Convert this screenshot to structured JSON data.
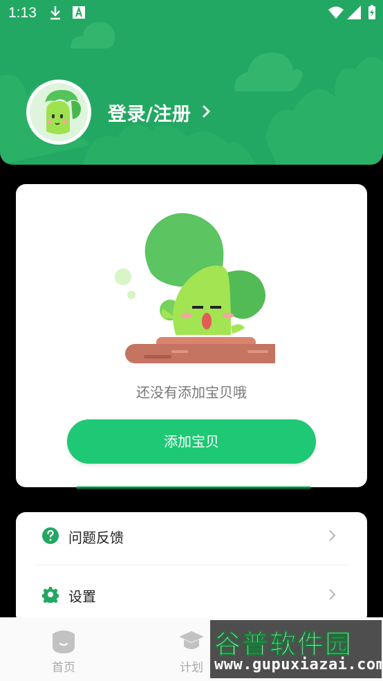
{
  "status_bar": {
    "time": "1:13",
    "icons": [
      "download-icon",
      "a11y-icon",
      "wifi-icon",
      "signal-icon",
      "battery-icon"
    ]
  },
  "header": {
    "login_label": "登录/注册",
    "chevron": "›",
    "bg_color": "#22a862"
  },
  "baby_card": {
    "empty_text": "还没有添加宝贝哦",
    "add_button_label": "添加宝贝",
    "button_color": "#1ec874"
  },
  "menu": {
    "items": [
      {
        "label": "问题反馈",
        "icon": "question-icon"
      },
      {
        "label": "设置",
        "icon": "gear-icon"
      }
    ]
  },
  "bottom_nav": {
    "items": [
      {
        "label": "首页",
        "icon": "home-face-icon"
      },
      {
        "label": "计划",
        "icon": "graduation-cap-icon"
      }
    ]
  },
  "watermark": {
    "title": "谷普软件园",
    "url": "www.gupuxiazai.com"
  }
}
